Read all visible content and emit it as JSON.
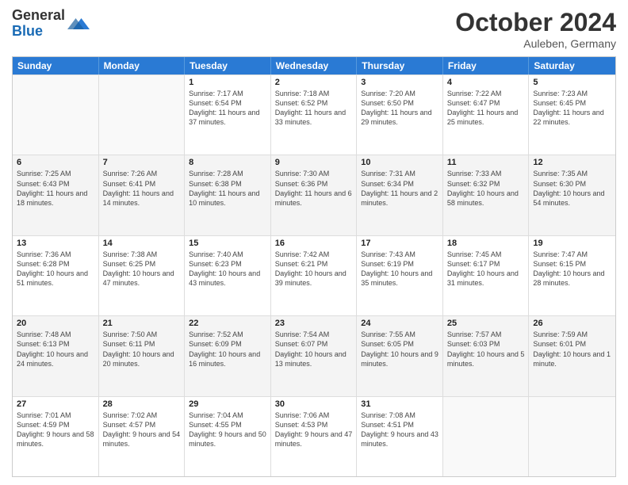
{
  "header": {
    "logo_general": "General",
    "logo_blue": "Blue",
    "month_title": "October 2024",
    "location": "Auleben, Germany"
  },
  "weekdays": [
    "Sunday",
    "Monday",
    "Tuesday",
    "Wednesday",
    "Thursday",
    "Friday",
    "Saturday"
  ],
  "rows": [
    [
      {
        "day": "",
        "text": "",
        "empty": true
      },
      {
        "day": "",
        "text": "",
        "empty": true
      },
      {
        "day": "1",
        "text": "Sunrise: 7:17 AM\nSunset: 6:54 PM\nDaylight: 11 hours and 37 minutes."
      },
      {
        "day": "2",
        "text": "Sunrise: 7:18 AM\nSunset: 6:52 PM\nDaylight: 11 hours and 33 minutes."
      },
      {
        "day": "3",
        "text": "Sunrise: 7:20 AM\nSunset: 6:50 PM\nDaylight: 11 hours and 29 minutes."
      },
      {
        "day": "4",
        "text": "Sunrise: 7:22 AM\nSunset: 6:47 PM\nDaylight: 11 hours and 25 minutes."
      },
      {
        "day": "5",
        "text": "Sunrise: 7:23 AM\nSunset: 6:45 PM\nDaylight: 11 hours and 22 minutes."
      }
    ],
    [
      {
        "day": "6",
        "text": "Sunrise: 7:25 AM\nSunset: 6:43 PM\nDaylight: 11 hours and 18 minutes."
      },
      {
        "day": "7",
        "text": "Sunrise: 7:26 AM\nSunset: 6:41 PM\nDaylight: 11 hours and 14 minutes."
      },
      {
        "day": "8",
        "text": "Sunrise: 7:28 AM\nSunset: 6:38 PM\nDaylight: 11 hours and 10 minutes."
      },
      {
        "day": "9",
        "text": "Sunrise: 7:30 AM\nSunset: 6:36 PM\nDaylight: 11 hours and 6 minutes."
      },
      {
        "day": "10",
        "text": "Sunrise: 7:31 AM\nSunset: 6:34 PM\nDaylight: 11 hours and 2 minutes."
      },
      {
        "day": "11",
        "text": "Sunrise: 7:33 AM\nSunset: 6:32 PM\nDaylight: 10 hours and 58 minutes."
      },
      {
        "day": "12",
        "text": "Sunrise: 7:35 AM\nSunset: 6:30 PM\nDaylight: 10 hours and 54 minutes."
      }
    ],
    [
      {
        "day": "13",
        "text": "Sunrise: 7:36 AM\nSunset: 6:28 PM\nDaylight: 10 hours and 51 minutes."
      },
      {
        "day": "14",
        "text": "Sunrise: 7:38 AM\nSunset: 6:25 PM\nDaylight: 10 hours and 47 minutes."
      },
      {
        "day": "15",
        "text": "Sunrise: 7:40 AM\nSunset: 6:23 PM\nDaylight: 10 hours and 43 minutes."
      },
      {
        "day": "16",
        "text": "Sunrise: 7:42 AM\nSunset: 6:21 PM\nDaylight: 10 hours and 39 minutes."
      },
      {
        "day": "17",
        "text": "Sunrise: 7:43 AM\nSunset: 6:19 PM\nDaylight: 10 hours and 35 minutes."
      },
      {
        "day": "18",
        "text": "Sunrise: 7:45 AM\nSunset: 6:17 PM\nDaylight: 10 hours and 31 minutes."
      },
      {
        "day": "19",
        "text": "Sunrise: 7:47 AM\nSunset: 6:15 PM\nDaylight: 10 hours and 28 minutes."
      }
    ],
    [
      {
        "day": "20",
        "text": "Sunrise: 7:48 AM\nSunset: 6:13 PM\nDaylight: 10 hours and 24 minutes."
      },
      {
        "day": "21",
        "text": "Sunrise: 7:50 AM\nSunset: 6:11 PM\nDaylight: 10 hours and 20 minutes."
      },
      {
        "day": "22",
        "text": "Sunrise: 7:52 AM\nSunset: 6:09 PM\nDaylight: 10 hours and 16 minutes."
      },
      {
        "day": "23",
        "text": "Sunrise: 7:54 AM\nSunset: 6:07 PM\nDaylight: 10 hours and 13 minutes."
      },
      {
        "day": "24",
        "text": "Sunrise: 7:55 AM\nSunset: 6:05 PM\nDaylight: 10 hours and 9 minutes."
      },
      {
        "day": "25",
        "text": "Sunrise: 7:57 AM\nSunset: 6:03 PM\nDaylight: 10 hours and 5 minutes."
      },
      {
        "day": "26",
        "text": "Sunrise: 7:59 AM\nSunset: 6:01 PM\nDaylight: 10 hours and 1 minute."
      }
    ],
    [
      {
        "day": "27",
        "text": "Sunrise: 7:01 AM\nSunset: 4:59 PM\nDaylight: 9 hours and 58 minutes."
      },
      {
        "day": "28",
        "text": "Sunrise: 7:02 AM\nSunset: 4:57 PM\nDaylight: 9 hours and 54 minutes."
      },
      {
        "day": "29",
        "text": "Sunrise: 7:04 AM\nSunset: 4:55 PM\nDaylight: 9 hours and 50 minutes."
      },
      {
        "day": "30",
        "text": "Sunrise: 7:06 AM\nSunset: 4:53 PM\nDaylight: 9 hours and 47 minutes."
      },
      {
        "day": "31",
        "text": "Sunrise: 7:08 AM\nSunset: 4:51 PM\nDaylight: 9 hours and 43 minutes."
      },
      {
        "day": "",
        "text": "",
        "empty": true
      },
      {
        "day": "",
        "text": "",
        "empty": true
      }
    ]
  ]
}
